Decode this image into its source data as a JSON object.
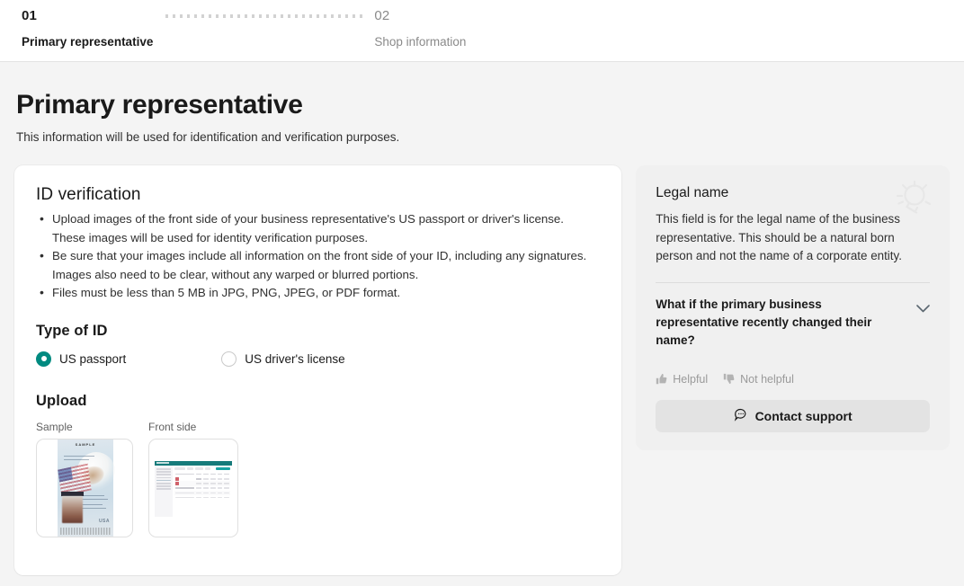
{
  "stepper": {
    "steps": [
      {
        "number": "01",
        "label": "Primary representative",
        "active": true
      },
      {
        "number": "02",
        "label": "Shop information",
        "active": false
      }
    ]
  },
  "page": {
    "title": "Primary representative",
    "subtitle": "This information will be used for identification and verification purposes."
  },
  "id_verification": {
    "heading": "ID verification",
    "bullets": [
      "Upload images of the front side of your business representative's US passport or driver's license. These images will be used for identity verification purposes.",
      "Be sure that your images include all information on the front side of your ID, including any signatures. Images also need to be clear, without any warped or blurred portions.",
      "Files must be less than 5 MB in JPG, PNG, JPEG, or PDF format."
    ],
    "type_of_id": {
      "label": "Type of ID",
      "options": [
        {
          "label": "US passport",
          "selected": true
        },
        {
          "label": "US driver's license",
          "selected": false
        }
      ]
    },
    "upload": {
      "label": "Upload",
      "items": [
        {
          "caption": "Sample",
          "image": "us-passport-sample",
          "watermark": "SAMPLE",
          "country": "USA"
        },
        {
          "caption": "Front side",
          "image": "uploaded-id-screenshot"
        }
      ]
    }
  },
  "help_panel": {
    "icon": "lightbulb-icon",
    "heading": "Legal name",
    "body": "This field is for the legal name of the business representative. This should be a natural born person and not the name of a corporate entity.",
    "faq": {
      "question": "What if the primary business representative recently changed their name?",
      "expand_icon": "chevron-down-icon"
    },
    "feedback": {
      "helpful_label": "Helpful",
      "not_helpful_label": "Not helpful",
      "helpful_icon": "thumbs-up-icon",
      "not_helpful_icon": "thumbs-down-icon"
    },
    "contact": {
      "label": "Contact support",
      "icon": "chat-bubble-icon"
    }
  },
  "colors": {
    "accent_teal": "#008a80",
    "page_background": "#f4f4f4",
    "card_background": "#ffffff",
    "help_background": "#f0f0f0",
    "muted_text": "#8a8a8a"
  }
}
